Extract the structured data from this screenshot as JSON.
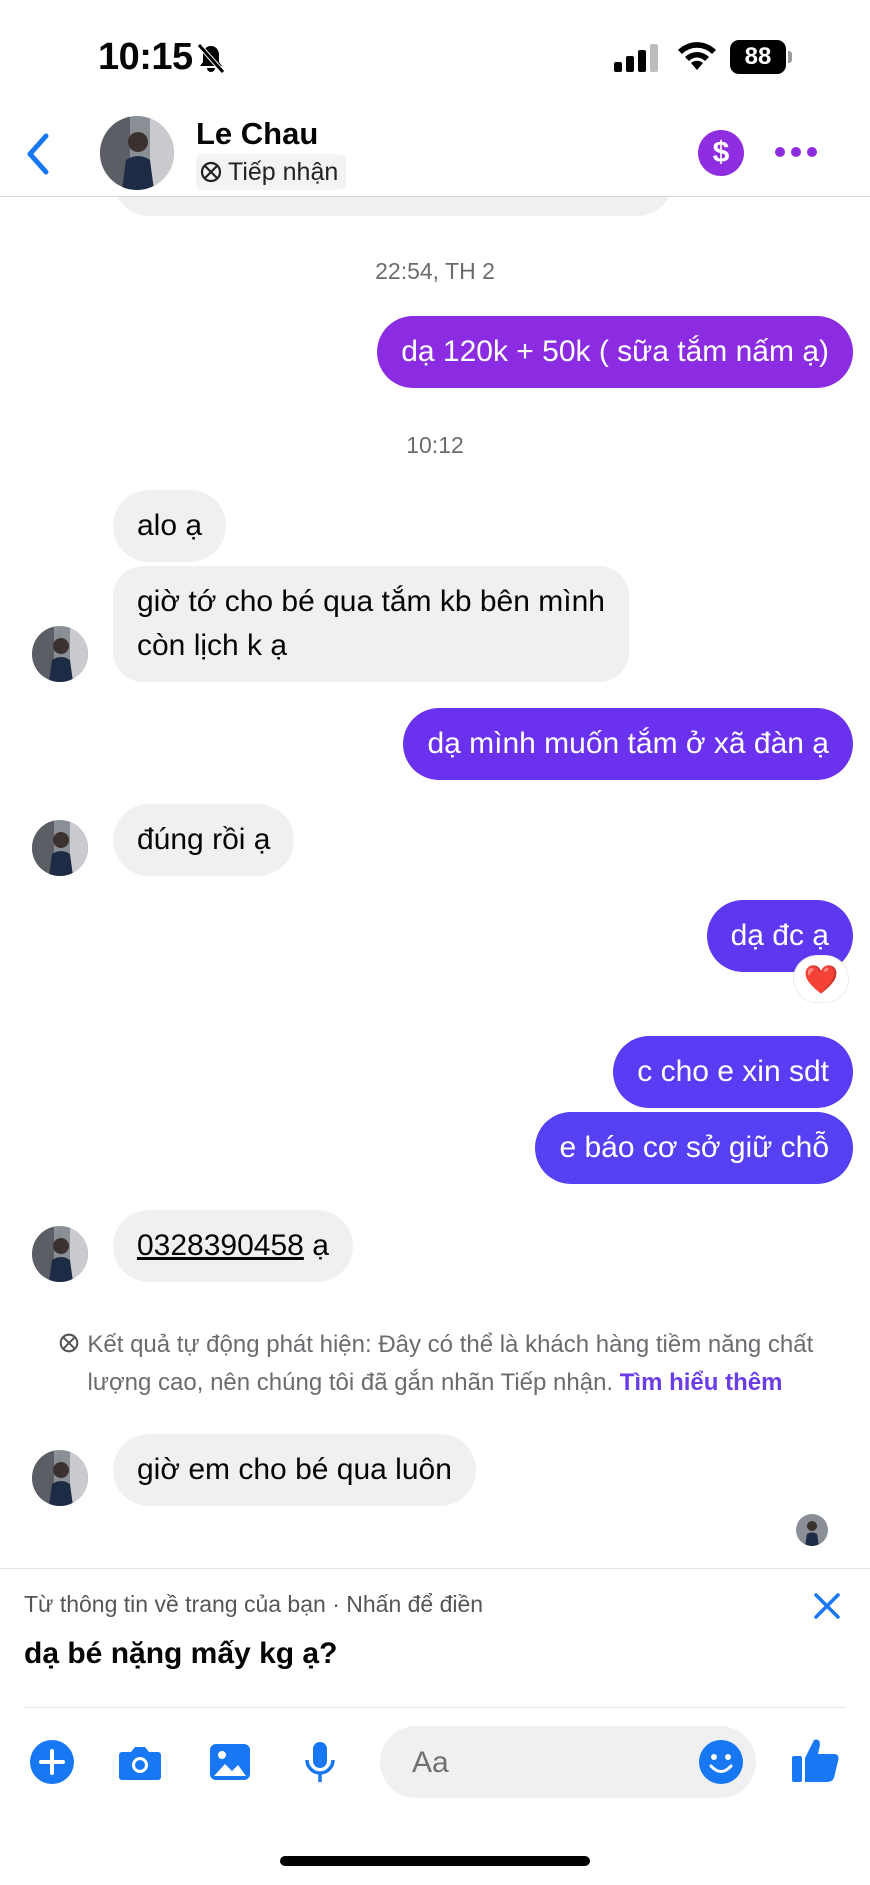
{
  "status_bar": {
    "time": "10:15",
    "battery": "88"
  },
  "header": {
    "contact_name": "Le Chau",
    "label": "Tiếp nhận"
  },
  "conversation": {
    "timestamp_1": "22:54, TH 2",
    "out_1": "dạ 120k + 50k ( sữa tắm nấm ạ)",
    "timestamp_2": "10:12",
    "in_1": "alo ạ",
    "in_2_line1": "giờ tớ cho bé qua tắm kb bên mình",
    "in_2_line2": "còn lịch k ạ",
    "out_2": "dạ mình muốn tắm ở xã đàn ạ",
    "in_3": "đúng rồi ạ",
    "out_3": "dạ đc ạ",
    "out_3_reaction": "❤️",
    "out_4": "c cho e xin sdt",
    "out_5": "e báo cơ sở giữ chỗ",
    "in_4_phone": "0328390458",
    "in_4_suffix": " ạ",
    "system_note": "Kết quả tự động phát hiện: Đây có thể là khách hàng tiềm năng chất lượng cao, nên chúng tôi đã gắn nhãn Tiếp nhận.",
    "system_note_link": "Tìm hiểu thêm",
    "in_5": "giờ em cho bé qua luôn"
  },
  "suggestion": {
    "hint": "Từ thông tin về trang của bạn · Nhấn để điền",
    "text": "dạ bé nặng mấy kg ạ?"
  },
  "composer": {
    "placeholder": "Aa"
  },
  "colors": {
    "accent_blue": "#1877f2",
    "bubble_purple": "#8b2be2",
    "bubble_indigo": "#5a3cf5",
    "incoming_bg": "#f0f0f2"
  },
  "icons": [
    "bell-slash-icon",
    "signal-icon",
    "wifi-icon",
    "back-icon",
    "label-icon",
    "dollar-icon",
    "more-icon",
    "heart-icon",
    "close-icon",
    "plus-icon",
    "camera-icon",
    "image-icon",
    "mic-icon",
    "emoji-icon",
    "like-icon"
  ]
}
